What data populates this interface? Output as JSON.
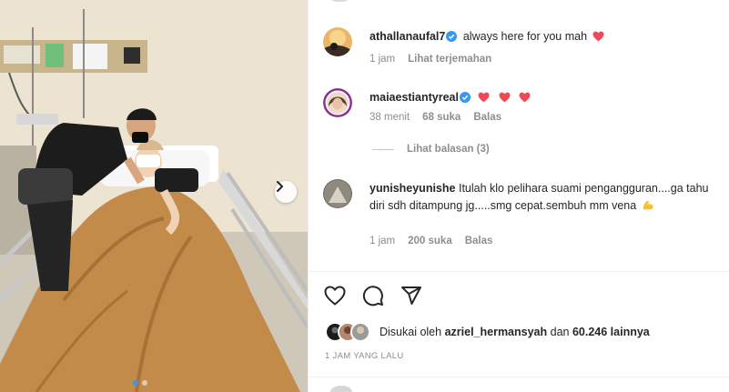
{
  "post": {
    "photo_alt_icon": "hospital-photo",
    "carousel_next_icon": "chevron-right-icon",
    "carousel_dots": 2
  },
  "comments": [
    {
      "username": "athallanaufal7",
      "verified": true,
      "text": "always here for you mah",
      "emoji": "heart-icon",
      "time": "1 jam",
      "translate": "Lihat terjemahan"
    },
    {
      "username": "maiaestiantyreal",
      "verified": true,
      "text": "",
      "emoji": "heart-icon x3",
      "time": "38 menit",
      "likes": "68 suka",
      "reply": "Balas",
      "view_replies": "Lihat balasan (3)"
    },
    {
      "username": "yunisheyunishe",
      "verified": false,
      "text": "Itulah klo pelihara suami pengangguran....ga tahu diri sdh ditampung jg.....smg cepat.sembuh mm vena",
      "emoji": "flexed-biceps-icon",
      "time": "1 jam",
      "likes": "200 suka",
      "reply": "Balas"
    }
  ],
  "actions": {
    "like_icon": "heart-outline-icon",
    "comment_icon": "comment-icon",
    "share_icon": "send-icon"
  },
  "likes": {
    "prefix": "Disukai oleh",
    "user": "azriel_hermansyah",
    "joiner": "dan",
    "others": "60.246 lainnya"
  },
  "timestamp": "1 JAM YANG LALU",
  "colors": {
    "heart_red": "#ed4956",
    "verified_blue": "#3897f0",
    "muted_text": "#8e8e8e",
    "text": "#262626",
    "emoji_yellow": "#f5c02a"
  }
}
